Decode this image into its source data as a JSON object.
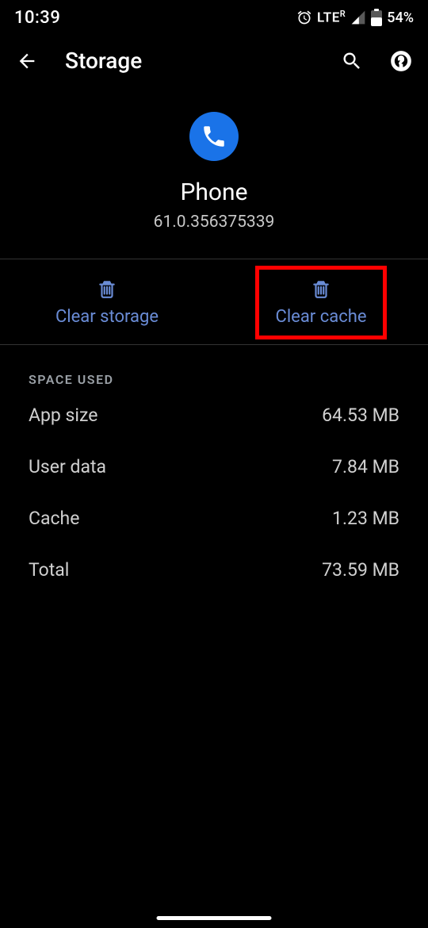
{
  "status": {
    "time": "10:39",
    "lte_label": "LTE",
    "lte_sup": "R",
    "battery_pct": "54%"
  },
  "toolbar": {
    "title": "Storage"
  },
  "app": {
    "name": "Phone",
    "version": "61.0.356375339"
  },
  "actions": {
    "clear_storage": "Clear storage",
    "clear_cache": "Clear cache"
  },
  "space": {
    "header": "SPACE USED",
    "rows": [
      {
        "label": "App size",
        "value": "64.53 MB"
      },
      {
        "label": "User data",
        "value": "7.84 MB"
      },
      {
        "label": "Cache",
        "value": "1.23 MB"
      },
      {
        "label": "Total",
        "value": "73.59 MB"
      }
    ]
  }
}
